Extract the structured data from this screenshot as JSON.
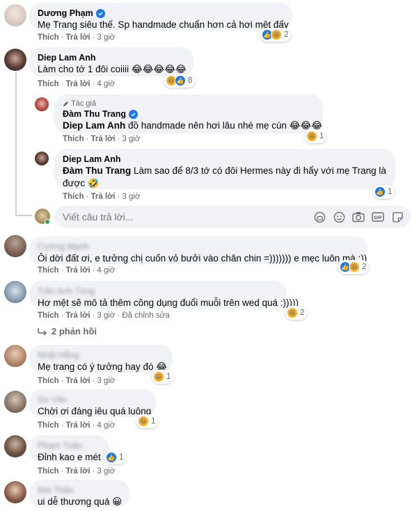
{
  "actions": {
    "like": "Thích",
    "reply": "Trả lời",
    "edited": "Đã chỉnh sửa"
  },
  "reply_input": {
    "placeholder": "Viết câu trả lời..."
  },
  "author_tag": "Tác giả",
  "view_replies": "2 phản hồi",
  "comments": [
    {
      "name": "Dương Phạm",
      "text": "Mẹ Trang siêu thế. Sp handmade chuẩn hơn cả hơi mệt đấy",
      "time": "3 giờ",
      "reactions": "2"
    },
    {
      "name": "Diep Lam Anh",
      "text": "Làm cho tớ 1 đôi coiiii 😂😂😂😂😂",
      "time": "4 giờ",
      "reactions": "8"
    },
    {
      "name": "Đàm Thu Trang",
      "mention": "Diep Lam Anh",
      "text": " đồ handmade nên hơi lâu nhé mẹ cún 😂😂😂",
      "time": "3 giờ",
      "reactions": "1"
    },
    {
      "name": "Diep Lam Anh",
      "mention": "Đàm Thu Trang",
      "text": " Làm sao để 8/3 tớ có đôi Hermes này đi hẩy với mẹ Trang là được 🤣",
      "time": "3 giờ",
      "reactions": "1"
    },
    {
      "name": "Cường Mạnh",
      "text": "Ôi dời đất ơi, e tưởng chị cuốn vỏ bưởi vào chân chin =))))))) e mẹc luôn mà :))",
      "time": "4 giờ",
      "reactions": "2"
    },
    {
      "name": "Trần Anh Tùng",
      "text": "Hơ mệt sẽ mô tả thêm công dụng đuổi muỗi trên wed quá :)))))",
      "time": "3 giờ",
      "reactions": "2"
    },
    {
      "name": "Nhật Hằng",
      "text": "Mẹ trang có ý tưởng hay đó 😂",
      "time": "3 giờ",
      "reactions": "1"
    },
    {
      "name": "Sơ Vân",
      "text": "Chời ơi đáng iêu quá luông",
      "time": "4 giờ",
      "reactions": "1"
    },
    {
      "name": "Phạm Tuấn",
      "text": "Đỉnh kao e mét",
      "time": "3 giờ",
      "reactions": "1"
    },
    {
      "name": "Mai Thảo",
      "text": "ui dễ thương quá 😀"
    }
  ]
}
